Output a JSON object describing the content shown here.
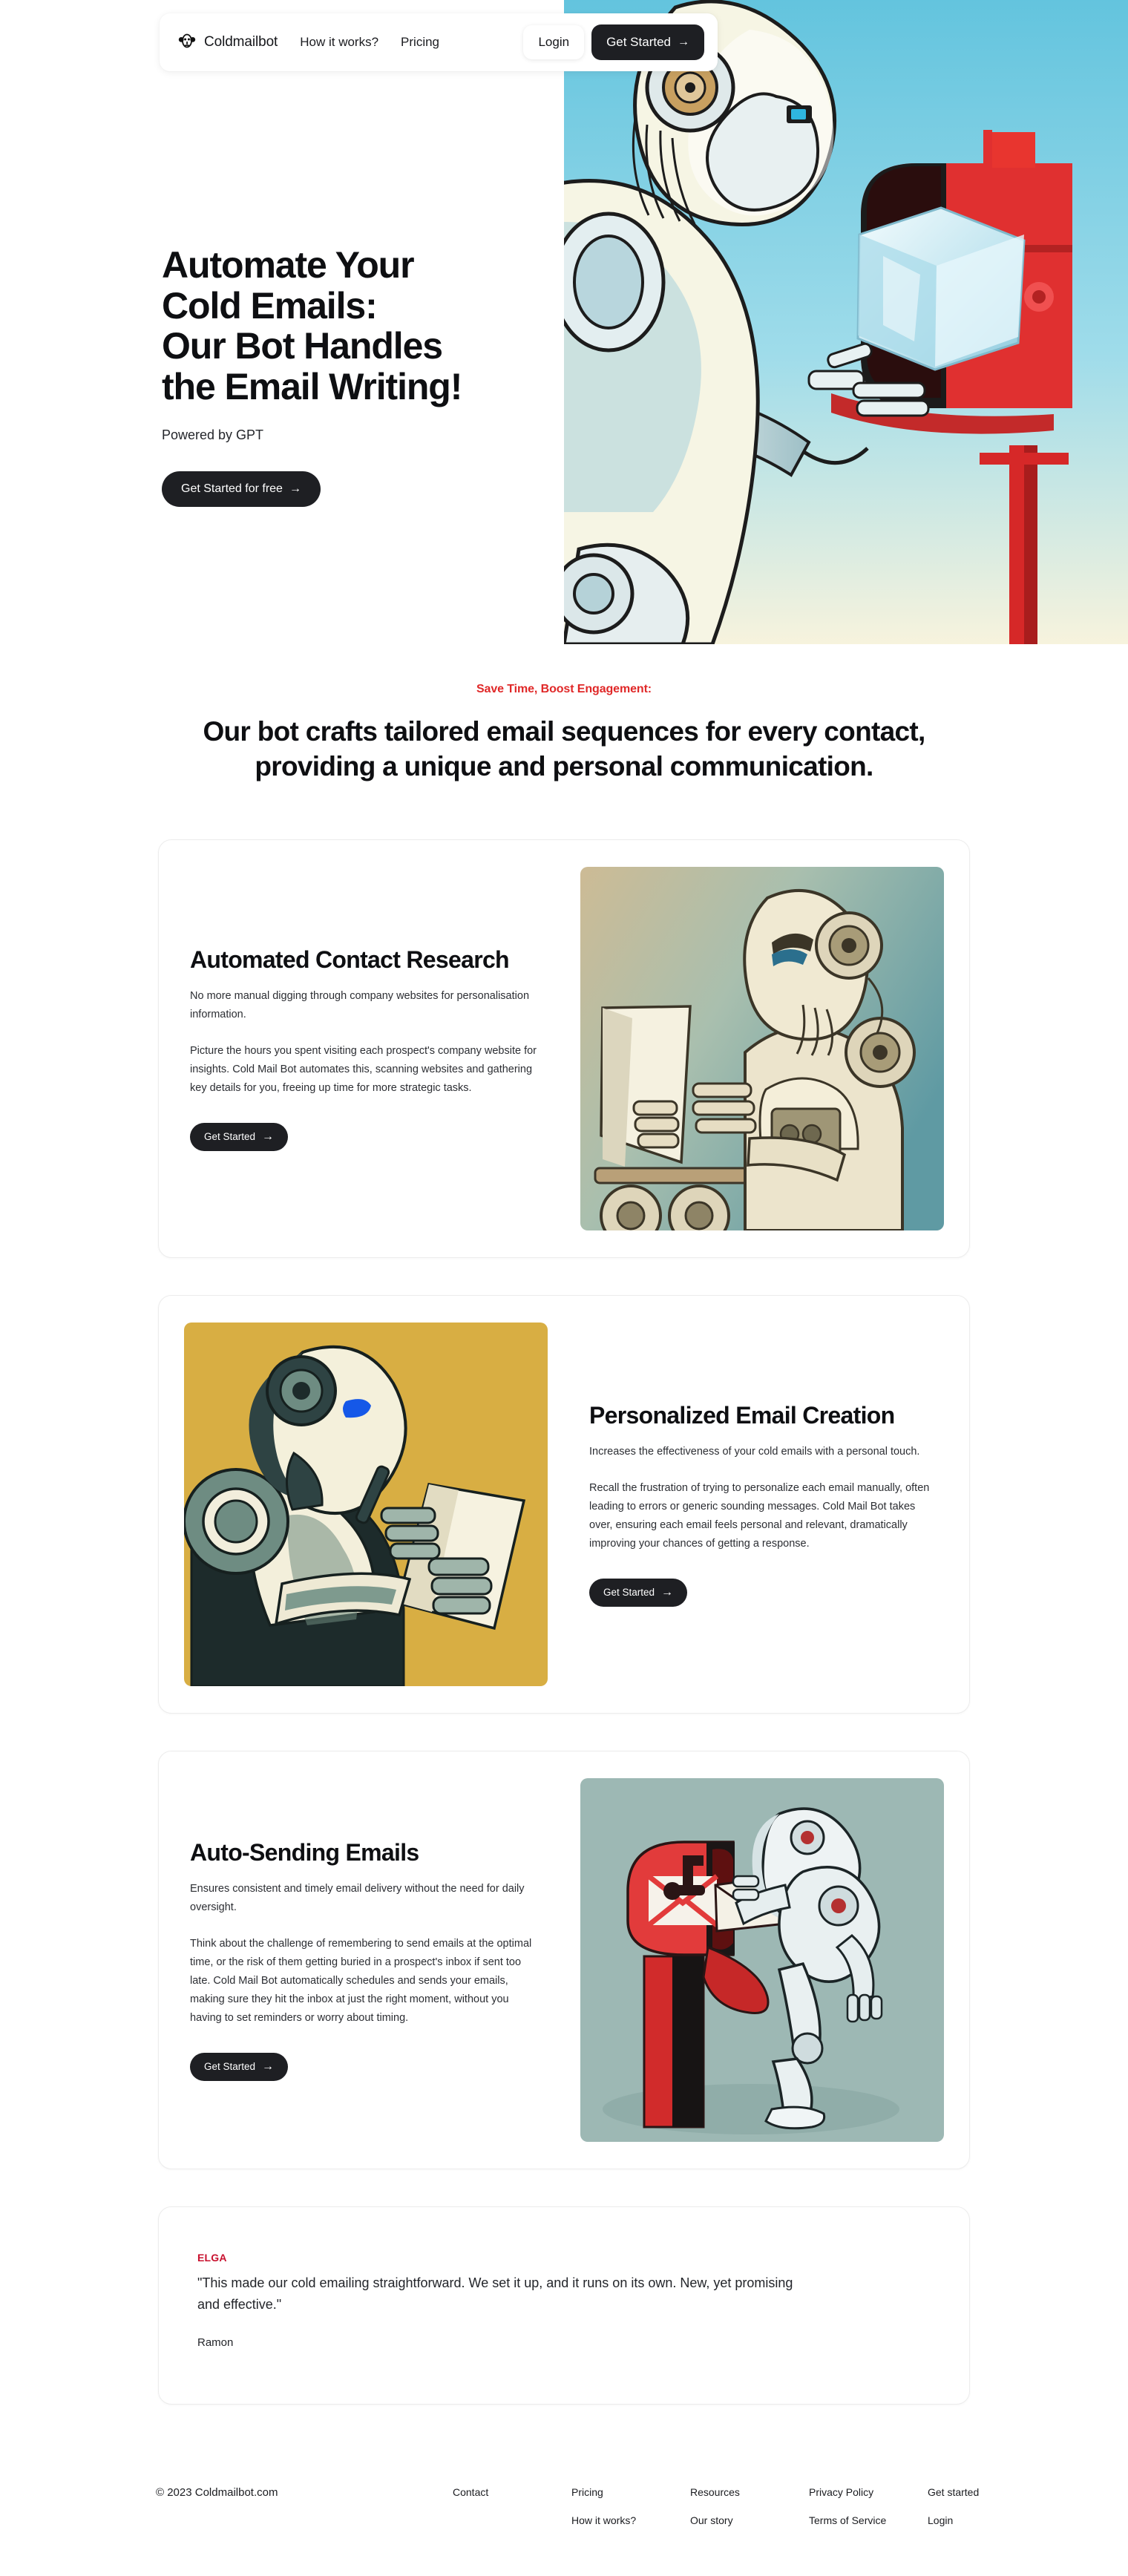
{
  "nav": {
    "brand": "Coldmailbot",
    "logo_icon": "robot-head-icon",
    "links": [
      {
        "label": "How it works?"
      },
      {
        "label": "Pricing"
      }
    ],
    "login_label": "Login",
    "cta_label": "Get Started",
    "cta_arrow": "→"
  },
  "hero": {
    "title": "Automate Your\nCold Emails:\nOur Bot Handles\nthe Email Writing!",
    "subtitle": "Powered by GPT",
    "cta_label": "Get Started for free",
    "cta_arrow": "→",
    "image_alt": "robot-placing-ice-cube-in-red-mailbox"
  },
  "section_header": {
    "eyebrow": "Save Time, Boost Engagement:",
    "eyebrow_color": "#e02828",
    "title": "Our bot crafts tailored email sequences for every contact, providing a unique and personal communication."
  },
  "features": [
    {
      "title": "Automated Contact Research",
      "lead": "No more manual digging through company websites for personalisation information.",
      "body": "Picture the hours you spent visiting each prospect's company website for insights. Cold Mail Bot automates this, scanning websites and gathering key details for you, freeing up time for more strategic tasks.",
      "cta_label": "Get Started",
      "cta_arrow": "→",
      "image_alt": "robot-reading-document-teal-background",
      "media_side": "right"
    },
    {
      "title": "Personalized Email Creation",
      "lead": "Increases the effectiveness of your cold emails with a personal touch.",
      "body": "Recall the frustration of trying to personalize each email manually, often leading to errors or generic sounding messages. Cold Mail Bot takes over, ensuring each email feels personal and relevant, dramatically improving your chances of getting a response.",
      "cta_label": "Get Started",
      "cta_arrow": "→",
      "image_alt": "robot-writing-letter-gold-background",
      "media_side": "left"
    },
    {
      "title": "Auto-Sending Emails",
      "lead": "Ensures consistent and timely email delivery without the need for daily oversight.",
      "body": "Think about the challenge of remembering to send emails at the optimal time, or the risk of them getting buried in a prospect's inbox if sent too late. Cold Mail Bot automatically schedules and sends your emails, making sure they hit the inbox at just the right moment, without you having to set reminders or worry about timing.",
      "cta_label": "Get Started",
      "cta_arrow": "→",
      "image_alt": "robot-posting-envelope-into-red-mailbox",
      "media_side": "right"
    }
  ],
  "testimonial": {
    "brand": "ELGA",
    "brand_color": "#c8102e",
    "quote": "\"This made our cold emailing straightforward. We set it up, and it runs on its own. New, yet promising and effective.\"",
    "author": "Ramon"
  },
  "footer": {
    "copyright": "© 2023 Coldmailbot.com",
    "columns": [
      {
        "links": [
          "Contact"
        ]
      },
      {
        "links": [
          "Pricing",
          "How it works?"
        ]
      },
      {
        "links": [
          "Resources",
          "Our story"
        ]
      },
      {
        "links": [
          "Privacy Policy",
          "Terms of Service"
        ]
      },
      {
        "links": [
          "Get started",
          "Login"
        ]
      }
    ]
  }
}
